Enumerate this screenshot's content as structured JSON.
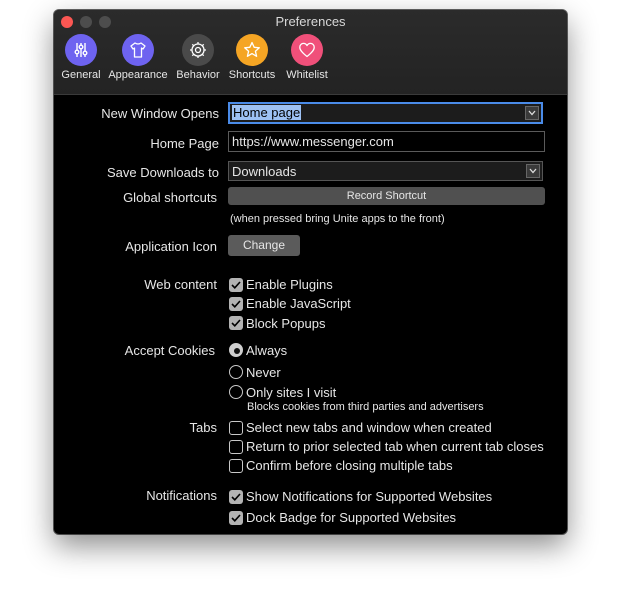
{
  "window": {
    "title": "Preferences"
  },
  "toolbar": {
    "tabs": [
      {
        "label": "General",
        "icon": "sliders-icon",
        "color": "#6e63f0"
      },
      {
        "label": "Appearance",
        "icon": "tshirt-icon",
        "color": "#6e63f0"
      },
      {
        "label": "Behavior",
        "icon": "gear-icon",
        "color": "#4a4a4a"
      },
      {
        "label": "Shortcuts",
        "icon": "star-icon",
        "color": "#f5a524"
      },
      {
        "label": "Whitelist",
        "icon": "heart-icon",
        "color": "#f0507a"
      }
    ]
  },
  "general": {
    "new_window": {
      "label": "New Window Opens",
      "value": "Home page"
    },
    "home_page": {
      "label": "Home Page",
      "value": "https://www.messenger.com"
    },
    "downloads": {
      "label": "Save Downloads to",
      "value": "Downloads"
    },
    "shortcuts": {
      "label": "Global shortcuts",
      "button": "Record Shortcut",
      "note": "(when pressed bring Unite apps to the front)"
    },
    "app_icon": {
      "label": "Application Icon",
      "button": "Change"
    },
    "web_content": {
      "label": "Web content",
      "options": [
        {
          "label": "Enable Plugins",
          "checked": true
        },
        {
          "label": "Enable JavaScript",
          "checked": true
        },
        {
          "label": "Block Popups",
          "checked": true
        }
      ]
    },
    "cookies": {
      "label": "Accept Cookies",
      "options": [
        {
          "label": "Always",
          "selected": true
        },
        {
          "label": "Never",
          "selected": false
        },
        {
          "label": "Only sites I visit",
          "selected": false
        }
      ],
      "note": "Blocks cookies from third parties and advertisers"
    },
    "tabs": {
      "label": "Tabs",
      "options": [
        {
          "label": "Select new tabs and window when created",
          "checked": false
        },
        {
          "label": "Return to prior selected tab when current tab closes",
          "checked": false
        },
        {
          "label": "Confirm before closing multiple tabs",
          "checked": false
        }
      ]
    },
    "notifications": {
      "label": "Notifications",
      "options": [
        {
          "label": "Show Notifications for Supported Websites",
          "checked": true
        },
        {
          "label": "Dock Badge for Supported Websites",
          "checked": true
        }
      ]
    }
  }
}
